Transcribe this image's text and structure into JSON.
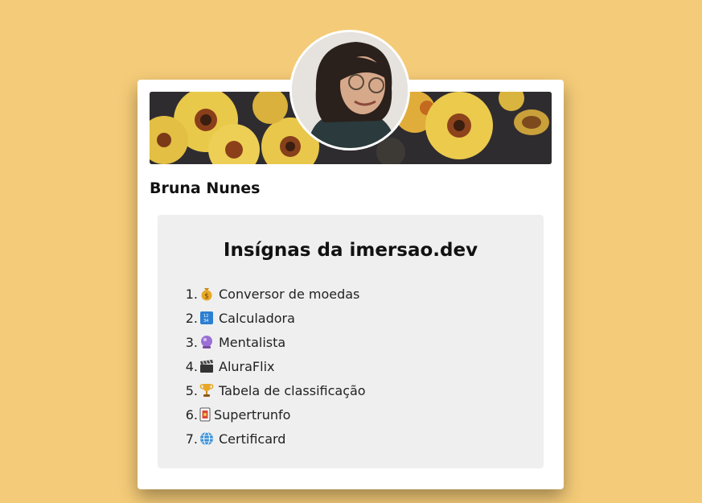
{
  "profile": {
    "name": "Bruna Nunes"
  },
  "badges": {
    "title": "Insígnas da imersao.dev",
    "items": [
      {
        "number": "1.",
        "icon": "money-bag-icon",
        "label": "Conversor de moedas"
      },
      {
        "number": "2.",
        "icon": "input-numbers-icon",
        "label": "Calculadora"
      },
      {
        "number": "3.",
        "icon": "crystal-ball-icon",
        "label": "Mentalista"
      },
      {
        "number": "4.",
        "icon": "clapper-board-icon",
        "label": "AluraFlix"
      },
      {
        "number": "5.",
        "icon": "trophy-icon",
        "label": "Tabela de classificação"
      },
      {
        "number": "6.",
        "icon": "playing-card-icon",
        "label": "Supertrunfo"
      },
      {
        "number": "7.",
        "icon": "globe-icon",
        "label": "Certificard"
      }
    ]
  },
  "colors": {
    "background": "#f4cb78",
    "card": "#ffffff",
    "badges_box": "#efefef"
  }
}
